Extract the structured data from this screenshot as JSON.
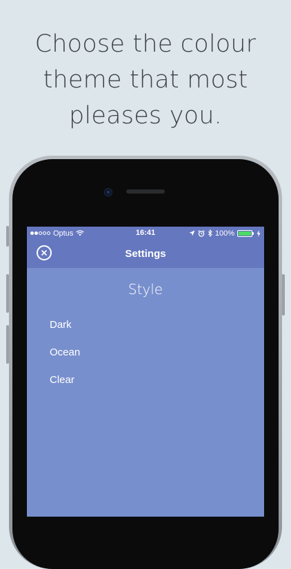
{
  "headline": {
    "line1": "Choose the colour",
    "line2": "theme that most",
    "line3": "pleases you."
  },
  "status_bar": {
    "carrier": "Optus",
    "time": "16:41",
    "battery": "100%",
    "signal_bars_filled": 2,
    "icons": [
      "wifi-icon",
      "location-arrow-icon",
      "alarm-icon",
      "bluetooth-icon",
      "battery-icon",
      "charging-bolt-icon"
    ]
  },
  "navbar": {
    "title": "Settings",
    "close_icon": "close-circle-icon"
  },
  "style_section": {
    "title": "Style",
    "options": [
      "Dark",
      "Ocean",
      "Clear"
    ]
  },
  "colors": {
    "page_background": "#dde6ea",
    "nav_background": "#6577bf",
    "screen_background": "#788fcd",
    "battery_fill": "#4cd964"
  }
}
